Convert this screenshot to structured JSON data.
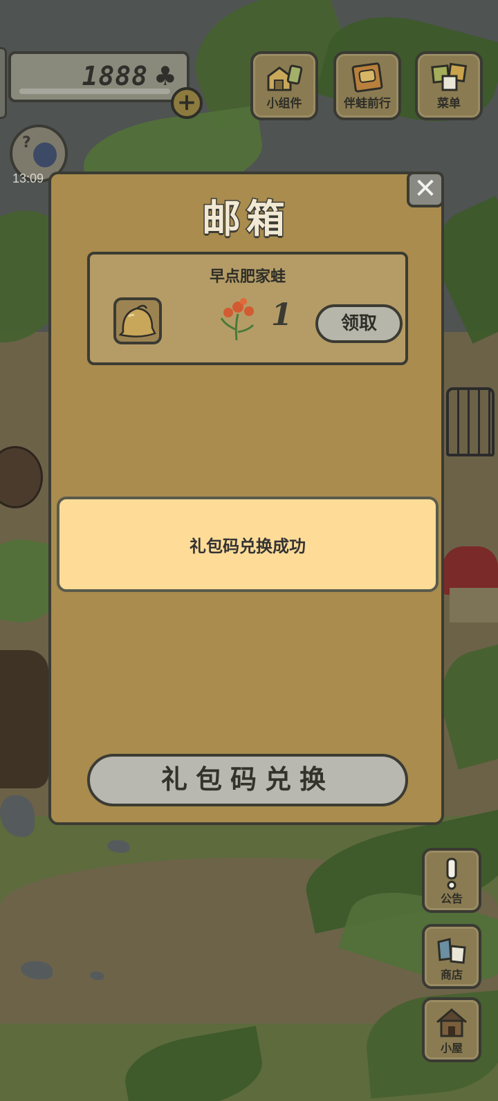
{
  "hud": {
    "clover_count": "1888",
    "clover_symbol": "♣",
    "plus_symbol": "+",
    "avatar_time": "13:09",
    "buttons": {
      "widgets": "小组件",
      "travel": "伴蛙前行",
      "menu": "菜单"
    }
  },
  "side": {
    "notice": "公告",
    "shop": "商店",
    "house": "小屋"
  },
  "dialog": {
    "title": "邮箱",
    "close_symbol": "✕",
    "mail": {
      "sender": "早点肥家蛙",
      "quantity": "1",
      "claim_label": "领取"
    },
    "toast": "礼包码兑换成功",
    "redeem_label": "礼包码兑换"
  },
  "colors": {
    "dialog_bg": "#a98c4e",
    "toast_bg": "#fedc98",
    "button_grey": "#b9b8b0"
  }
}
